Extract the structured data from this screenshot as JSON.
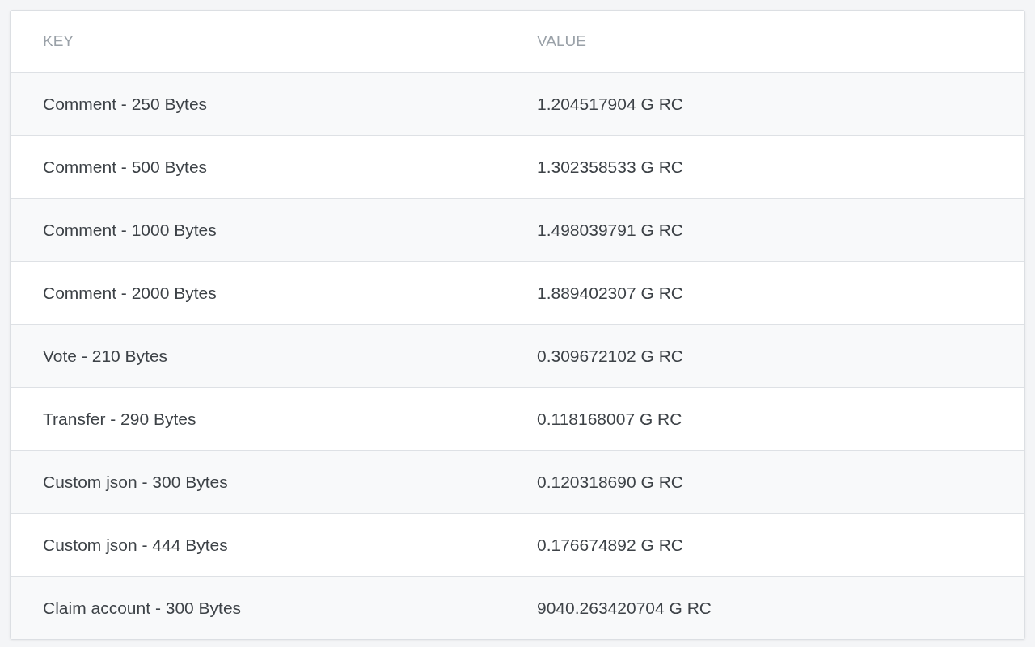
{
  "table": {
    "columns": [
      "KEY",
      "VALUE"
    ],
    "rows": [
      {
        "key": "Comment - 250 Bytes",
        "value": "1.204517904 G RC"
      },
      {
        "key": "Comment - 500 Bytes",
        "value": "1.302358533 G RC"
      },
      {
        "key": "Comment - 1000 Bytes",
        "value": "1.498039791 G RC"
      },
      {
        "key": "Comment - 2000 Bytes",
        "value": "1.889402307 G RC"
      },
      {
        "key": "Vote - 210 Bytes",
        "value": "0.309672102 G RC"
      },
      {
        "key": "Transfer - 290 Bytes",
        "value": "0.118168007 G RC"
      },
      {
        "key": "Custom json - 300 Bytes",
        "value": "0.120318690 G RC"
      },
      {
        "key": "Custom json - 444 Bytes",
        "value": "0.176674892 G RC"
      },
      {
        "key": "Claim account - 300 Bytes",
        "value": "9040.263420704 G RC"
      }
    ]
  }
}
